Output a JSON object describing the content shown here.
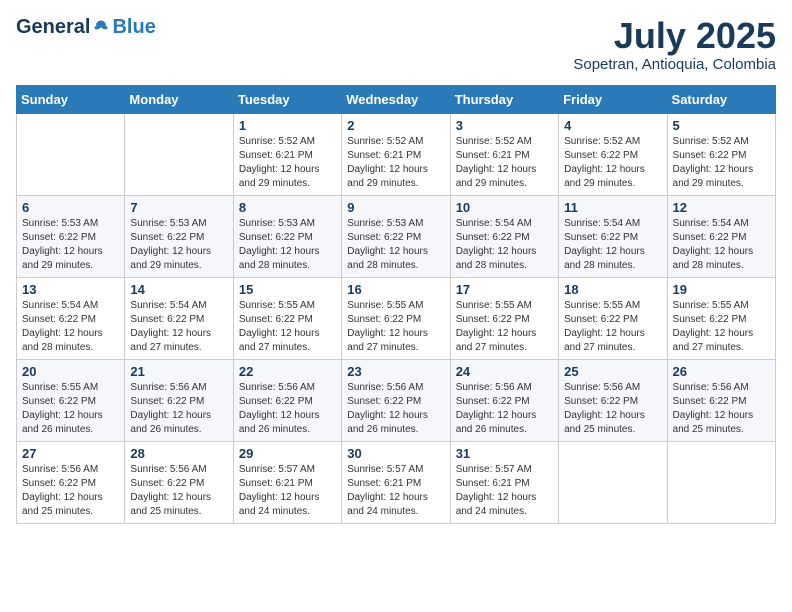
{
  "header": {
    "logo_general": "General",
    "logo_blue": "Blue",
    "month_year": "July 2025",
    "location": "Sopetran, Antioquia, Colombia"
  },
  "days_of_week": [
    "Sunday",
    "Monday",
    "Tuesday",
    "Wednesday",
    "Thursday",
    "Friday",
    "Saturday"
  ],
  "weeks": [
    [
      {
        "day": "",
        "info": ""
      },
      {
        "day": "",
        "info": ""
      },
      {
        "day": "1",
        "info": "Sunrise: 5:52 AM\nSunset: 6:21 PM\nDaylight: 12 hours and 29 minutes."
      },
      {
        "day": "2",
        "info": "Sunrise: 5:52 AM\nSunset: 6:21 PM\nDaylight: 12 hours and 29 minutes."
      },
      {
        "day": "3",
        "info": "Sunrise: 5:52 AM\nSunset: 6:21 PM\nDaylight: 12 hours and 29 minutes."
      },
      {
        "day": "4",
        "info": "Sunrise: 5:52 AM\nSunset: 6:22 PM\nDaylight: 12 hours and 29 minutes."
      },
      {
        "day": "5",
        "info": "Sunrise: 5:52 AM\nSunset: 6:22 PM\nDaylight: 12 hours and 29 minutes."
      }
    ],
    [
      {
        "day": "6",
        "info": "Sunrise: 5:53 AM\nSunset: 6:22 PM\nDaylight: 12 hours and 29 minutes."
      },
      {
        "day": "7",
        "info": "Sunrise: 5:53 AM\nSunset: 6:22 PM\nDaylight: 12 hours and 29 minutes."
      },
      {
        "day": "8",
        "info": "Sunrise: 5:53 AM\nSunset: 6:22 PM\nDaylight: 12 hours and 28 minutes."
      },
      {
        "day": "9",
        "info": "Sunrise: 5:53 AM\nSunset: 6:22 PM\nDaylight: 12 hours and 28 minutes."
      },
      {
        "day": "10",
        "info": "Sunrise: 5:54 AM\nSunset: 6:22 PM\nDaylight: 12 hours and 28 minutes."
      },
      {
        "day": "11",
        "info": "Sunrise: 5:54 AM\nSunset: 6:22 PM\nDaylight: 12 hours and 28 minutes."
      },
      {
        "day": "12",
        "info": "Sunrise: 5:54 AM\nSunset: 6:22 PM\nDaylight: 12 hours and 28 minutes."
      }
    ],
    [
      {
        "day": "13",
        "info": "Sunrise: 5:54 AM\nSunset: 6:22 PM\nDaylight: 12 hours and 28 minutes."
      },
      {
        "day": "14",
        "info": "Sunrise: 5:54 AM\nSunset: 6:22 PM\nDaylight: 12 hours and 27 minutes."
      },
      {
        "day": "15",
        "info": "Sunrise: 5:55 AM\nSunset: 6:22 PM\nDaylight: 12 hours and 27 minutes."
      },
      {
        "day": "16",
        "info": "Sunrise: 5:55 AM\nSunset: 6:22 PM\nDaylight: 12 hours and 27 minutes."
      },
      {
        "day": "17",
        "info": "Sunrise: 5:55 AM\nSunset: 6:22 PM\nDaylight: 12 hours and 27 minutes."
      },
      {
        "day": "18",
        "info": "Sunrise: 5:55 AM\nSunset: 6:22 PM\nDaylight: 12 hours and 27 minutes."
      },
      {
        "day": "19",
        "info": "Sunrise: 5:55 AM\nSunset: 6:22 PM\nDaylight: 12 hours and 27 minutes."
      }
    ],
    [
      {
        "day": "20",
        "info": "Sunrise: 5:55 AM\nSunset: 6:22 PM\nDaylight: 12 hours and 26 minutes."
      },
      {
        "day": "21",
        "info": "Sunrise: 5:56 AM\nSunset: 6:22 PM\nDaylight: 12 hours and 26 minutes."
      },
      {
        "day": "22",
        "info": "Sunrise: 5:56 AM\nSunset: 6:22 PM\nDaylight: 12 hours and 26 minutes."
      },
      {
        "day": "23",
        "info": "Sunrise: 5:56 AM\nSunset: 6:22 PM\nDaylight: 12 hours and 26 minutes."
      },
      {
        "day": "24",
        "info": "Sunrise: 5:56 AM\nSunset: 6:22 PM\nDaylight: 12 hours and 26 minutes."
      },
      {
        "day": "25",
        "info": "Sunrise: 5:56 AM\nSunset: 6:22 PM\nDaylight: 12 hours and 25 minutes."
      },
      {
        "day": "26",
        "info": "Sunrise: 5:56 AM\nSunset: 6:22 PM\nDaylight: 12 hours and 25 minutes."
      }
    ],
    [
      {
        "day": "27",
        "info": "Sunrise: 5:56 AM\nSunset: 6:22 PM\nDaylight: 12 hours and 25 minutes."
      },
      {
        "day": "28",
        "info": "Sunrise: 5:56 AM\nSunset: 6:22 PM\nDaylight: 12 hours and 25 minutes."
      },
      {
        "day": "29",
        "info": "Sunrise: 5:57 AM\nSunset: 6:21 PM\nDaylight: 12 hours and 24 minutes."
      },
      {
        "day": "30",
        "info": "Sunrise: 5:57 AM\nSunset: 6:21 PM\nDaylight: 12 hours and 24 minutes."
      },
      {
        "day": "31",
        "info": "Sunrise: 5:57 AM\nSunset: 6:21 PM\nDaylight: 12 hours and 24 minutes."
      },
      {
        "day": "",
        "info": ""
      },
      {
        "day": "",
        "info": ""
      }
    ]
  ]
}
